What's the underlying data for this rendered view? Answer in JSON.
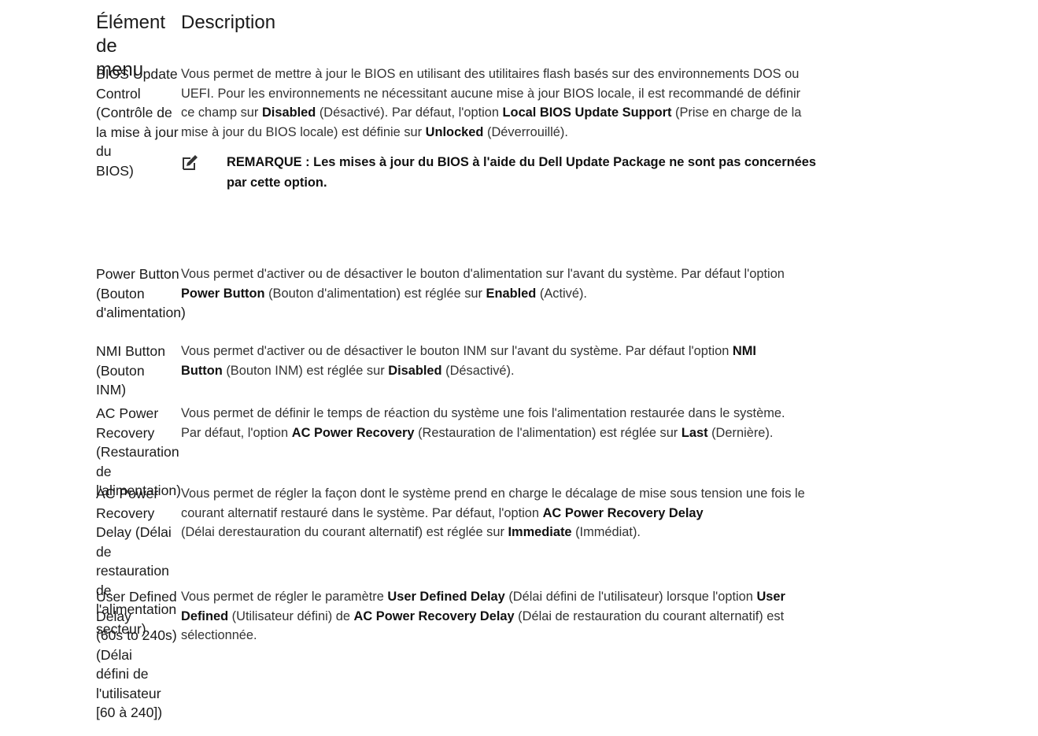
{
  "header": {
    "col1_line1": "Élément de",
    "col1_line2": "menu",
    "col2": "Description"
  },
  "rows": [
    {
      "item_lines": [
        "BIOS Update",
        "Control (Contrôle de",
        "la mise à jour du",
        "BIOS)"
      ],
      "desc": [
        {
          "t": "Vous permet de mettre à jour le BIOS en utilisant des utilitaires flash basés sur des environnements DOS ou"
        },
        {
          "t": "UEFI. Pour les environnements ne nécessitant aucune mise à jour BIOS locale, il est recommandé de définir"
        },
        {
          "t": "ce champ sur "
        },
        {
          "b": "Disabled"
        },
        {
          "t": " (Désactivé). Par défaut, l'option "
        },
        {
          "b": "Local BIOS Update Support"
        },
        {
          "t": " (Prise en charge de la"
        },
        {
          "t": "mise à jour du BIOS locale) est définie sur "
        },
        {
          "b": "Unlocked"
        },
        {
          "t": " (Déverrouillé)."
        }
      ],
      "note_lines": [
        "REMARQUE : Les mises à jour du BIOS à l'aide du Dell Update Package ne sont pas concernées",
        "par cette option."
      ],
      "note_icon": "pencil-note-icon"
    },
    {
      "item_lines": [
        "Power Button",
        "(Bouton",
        "d'alimentation)"
      ],
      "desc": [
        {
          "t": "Vous permet d'activer ou de désactiver le bouton d'alimentation sur l'avant du système. Par défaut l'option"
        },
        {
          "b": "Power Button"
        },
        {
          "t": " (Bouton d'alimentation) est réglée sur "
        },
        {
          "b": "Enabled"
        },
        {
          "t": " (Activé)."
        }
      ]
    },
    {
      "item_lines": [
        "NMI Button (Bouton",
        "INM)"
      ],
      "desc": [
        {
          "t": "Vous permet d'activer ou de désactiver le bouton INM sur l'avant du système. Par défaut l'option "
        },
        {
          "b": "NMI"
        },
        {
          "b": "Button"
        },
        {
          "t": " (Bouton INM) est réglée sur "
        },
        {
          "b": "Disabled"
        },
        {
          "t": " (Désactivé)."
        }
      ]
    },
    {
      "item_lines": [
        "AC Power Recovery",
        "(Restauration de",
        "l'alimentation)"
      ],
      "desc": [
        {
          "t": "Vous permet de définir le temps de réaction du système une fois l'alimentation restaurée dans le système."
        },
        {
          "t": "Par défaut, l'option "
        },
        {
          "b": "AC Power Recovery"
        },
        {
          "t": " (Restauration de l'alimentation) est réglée sur "
        },
        {
          "b": "Last"
        },
        {
          "t": " (Dernière)."
        }
      ]
    },
    {
      "item_lines": [
        "AC Power Recovery",
        "Delay (Délai de",
        "restauration de",
        "l'alimentation",
        "secteur)"
      ],
      "desc": [
        {
          "t": "Vous permet de régler la façon dont le système prend en charge le décalage de mise sous tension une fois le"
        },
        {
          "t": "courant alternatif restauré dans le système. Par défaut, l'option "
        },
        {
          "b": "AC Power Recovery Delay"
        },
        {
          "t": " (Délai de"
        },
        {
          "t": "restauration du courant alternatif) est réglée sur "
        },
        {
          "b": "Immediate"
        },
        {
          "t": " (Immédiat)."
        }
      ]
    },
    {
      "item_lines": [
        "User Defined Delay",
        "(60s to 240s) (Délai",
        "défini de l'utilisateur",
        "[60 à 240])"
      ],
      "desc": [
        {
          "t": "Vous permet de régler le paramètre "
        },
        {
          "b": "User Defined Delay"
        },
        {
          "t": " (Délai défini de l'utilisateur) lorsque l'option "
        },
        {
          "b": "User"
        },
        {
          "b": "Defined"
        },
        {
          "t": " (Utilisateur défini) de "
        },
        {
          "b": "AC Power Recovery Delay"
        },
        {
          "t": " (Délai de restauration du courant alternatif) est"
        },
        {
          "t": "sélectionnée."
        }
      ]
    }
  ]
}
